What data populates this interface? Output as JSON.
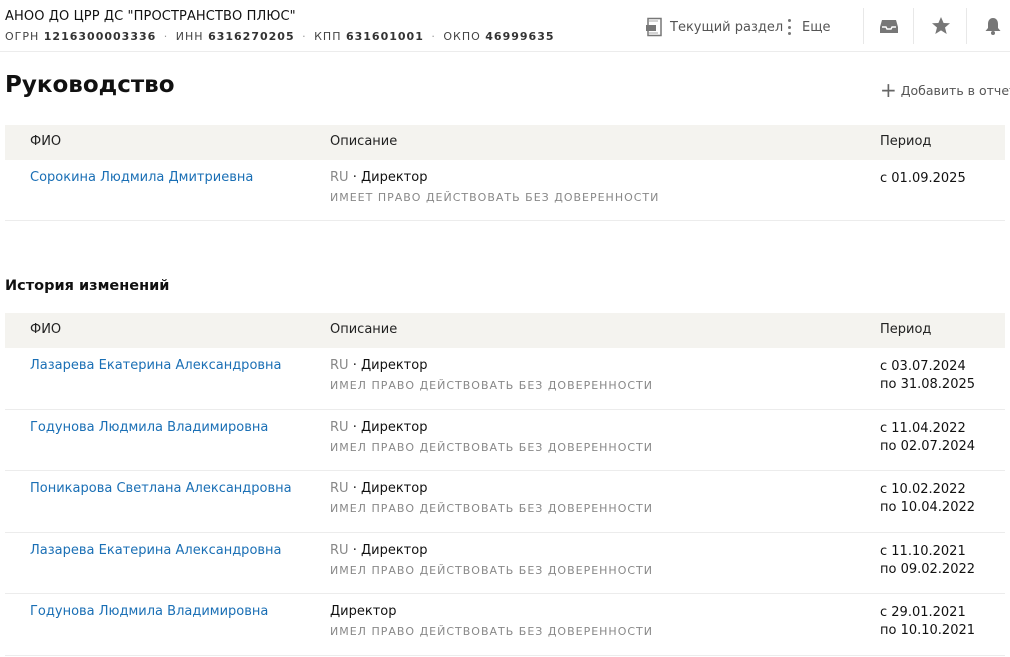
{
  "header": {
    "company_name": "АНОО ДО ЦРР ДС \"ПРОСТРАНСТВО ПЛЮС\"",
    "ids": [
      {
        "label": "ОГРН",
        "value": "1216300003336"
      },
      {
        "label": "ИНН",
        "value": "6316270205"
      },
      {
        "label": "КПП",
        "value": "631601001"
      },
      {
        "label": "ОКПО",
        "value": "46999635"
      }
    ],
    "separator": "·",
    "actions": {
      "current_section_label": "Текущий раздел",
      "more_label": "Еще"
    },
    "icons": [
      "pdf-icon",
      "more-vertical-icon",
      "inbox-icon",
      "star-icon",
      "bell-icon"
    ]
  },
  "management": {
    "title": "Руководство",
    "add_report_label": "Добавить в отчет",
    "columns": [
      "ФИО",
      "Описание",
      "Период"
    ],
    "rows": [
      {
        "name": "Сорокина Людмила Дмитриевна",
        "lang": "RU",
        "role": "Директор",
        "note": "ИМЕЕТ ПРАВО ДЕЙСТВОВАТЬ БЕЗ ДОВЕРЕННОСТИ",
        "period_from": "с 01.09.2025",
        "period_to": ""
      }
    ]
  },
  "history": {
    "title": "История изменений",
    "columns": [
      "ФИО",
      "Описание",
      "Период"
    ],
    "rows": [
      {
        "name": "Лазарева Екатерина Александровна",
        "lang": "RU",
        "role": "Директор",
        "note": "ИМЕЛ ПРАВО ДЕЙСТВОВАТЬ БЕЗ ДОВЕРЕННОСТИ",
        "period_from": "с 03.07.2024",
        "period_to": "по 31.08.2025"
      },
      {
        "name": "Годунова Людмила Владимировна",
        "lang": "RU",
        "role": "Директор",
        "note": "ИМЕЛ ПРАВО ДЕЙСТВОВАТЬ БЕЗ ДОВЕРЕННОСТИ",
        "period_from": "с 11.04.2022",
        "period_to": "по 02.07.2024"
      },
      {
        "name": "Поникарова Светлана Александровна",
        "lang": "RU",
        "role": "Директор",
        "note": "ИМЕЛ ПРАВО ДЕЙСТВОВАТЬ БЕЗ ДОВЕРЕННОСТИ",
        "period_from": "с 10.02.2022",
        "period_to": "по 10.04.2022"
      },
      {
        "name": "Лазарева Екатерина Александровна",
        "lang": "RU",
        "role": "Директор",
        "note": "ИМЕЛ ПРАВО ДЕЙСТВОВАТЬ БЕЗ ДОВЕРЕННОСТИ",
        "period_from": "с 11.10.2021",
        "period_to": "по 09.02.2022"
      },
      {
        "name": "Годунова Людмила Владимировна",
        "lang": "",
        "role": "Директор",
        "note": "ИМЕЛ ПРАВО ДЕЙСТВОВАТЬ БЕЗ ДОВЕРЕННОСТИ",
        "period_from": "с 29.01.2021",
        "period_to": "по 10.10.2021"
      }
    ]
  },
  "colors": {
    "link": "#1a6fb5",
    "table_header_bg": "#f4f3ef",
    "muted": "#888888"
  }
}
